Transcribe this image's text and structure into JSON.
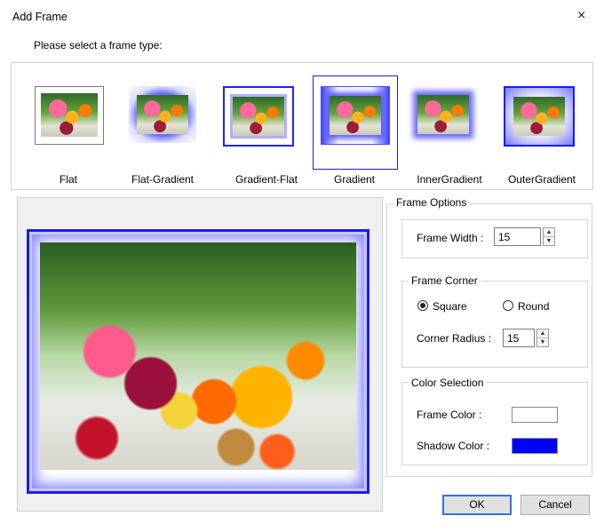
{
  "window": {
    "title": "Add Frame",
    "close_glyph": "×"
  },
  "instruction": "Please select a frame type:",
  "frame_types": [
    {
      "label": "Flat"
    },
    {
      "label": "Flat-Gradient"
    },
    {
      "label": "Gradient-Flat"
    },
    {
      "label": "Gradient",
      "selected": true
    },
    {
      "label": "InnerGradient"
    },
    {
      "label": "OuterGradient"
    }
  ],
  "options": {
    "title": "Frame Options",
    "frame_width_label": "Frame Width :",
    "frame_width": "15",
    "corner": {
      "title": "Frame Corner",
      "square_label": "Square",
      "round_label": "Round",
      "selected": "Square",
      "radius_label": "Corner Radius :",
      "radius": "15"
    },
    "color": {
      "title": "Color Selection",
      "frame_color_label": "Frame Color :",
      "frame_color": "#ffffff",
      "shadow_color_label": "Shadow Color :",
      "shadow_color": "#0000ff"
    }
  },
  "buttons": {
    "ok": "OK",
    "cancel": "Cancel"
  }
}
